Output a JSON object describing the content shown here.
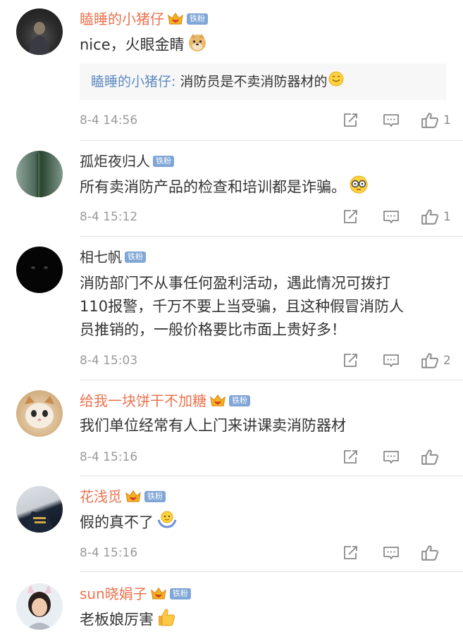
{
  "colors": {
    "vip_name": "#eb7350",
    "normal_name": "#333333",
    "badge_bg": "#7fa6d6",
    "quote_name": "#5d8ac0",
    "meta": "#9a9a9a"
  },
  "comments": [
    {
      "username": "瞌睡的小猪仔",
      "has_crown": true,
      "badge": "铁粉",
      "text": "nice，火眼金睛",
      "emoji": "doge-emoji",
      "quote_name": "瞌睡的小猪仔:",
      "quote_text": " 消防员是不卖消防器材的",
      "quote_emoji": "smile-emoji",
      "time": "8-4 14:56",
      "likes": "1"
    },
    {
      "username": "孤炬夜归人",
      "has_crown": false,
      "badge": "铁粉",
      "text": "所有卖消防产品的检查和培训都是诈骗。",
      "emoji": "glasses-emoji",
      "time": "8-4 15:12",
      "likes": "1"
    },
    {
      "username": "相七帆",
      "has_crown": false,
      "badge": "铁粉",
      "text_lines": [
        "消防部门不从事任何盈利活动，遇此情况可拨打",
        "110报警，千万不要上当受骗，且这种假冒消防人",
        "员推销的，一般价格要比市面上贵好多！"
      ],
      "time": "8-4 15:03",
      "likes": "2"
    },
    {
      "username": "给我一块饼干不加糖",
      "has_crown": true,
      "badge": "铁粉",
      "text": "我们单位经常有人上门来讲课卖消防器材",
      "time": "8-4 15:16",
      "likes": ""
    },
    {
      "username": "花浅觅",
      "has_crown": true,
      "badge": "铁粉",
      "text": "假的真不了",
      "emoji": "shrug-emoji",
      "time": "8-4 15:16",
      "likes": ""
    },
    {
      "username": "sun晓娟子",
      "has_crown": true,
      "badge": "铁粉",
      "text": "老板娘厉害",
      "emoji": "thumbs-up-emoji"
    }
  ]
}
